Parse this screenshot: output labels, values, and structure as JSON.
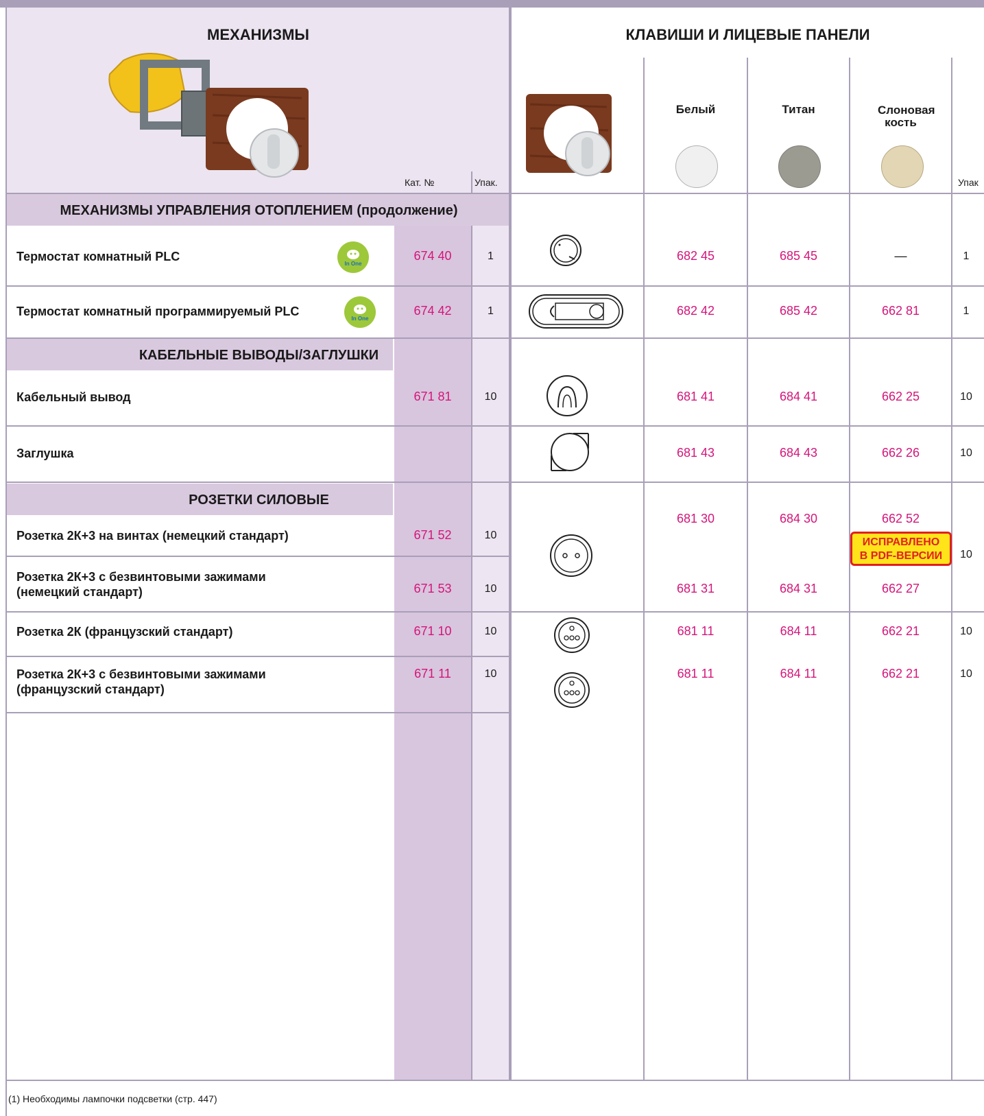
{
  "left_header": {
    "title": "МЕХАНИЗМЫ",
    "cat_label": "Кат. №",
    "pack_label": "Упак."
  },
  "right_header": {
    "title": "КЛАВИШИ И ЛИЦЕВЫЕ ПАНЕЛИ",
    "colors": [
      {
        "name": "Белый",
        "swatch": "#f0f0f0"
      },
      {
        "name": "Титан",
        "swatch": "#9c9b92"
      },
      {
        "name": "Слоновая кость",
        "swatch": "#e3d6b4"
      }
    ],
    "pack_label": "Упак"
  },
  "sections": {
    "heating": "МЕХАНИЗМЫ УПРАВЛЕНИЯ ОТОПЛЕНИЕМ (продолжение)",
    "cable": "КАБЕЛЬНЫЕ ВЫВОДЫ/ЗАГЛУШКИ",
    "sockets": "РОЗЕТКИ СИЛОВЫЕ"
  },
  "badge": "In One",
  "rows": [
    {
      "label": "Термостат комнатный PLC",
      "cat": "674 40",
      "pack": "1",
      "white": "682 45",
      "titan": "685 45",
      "ivory": "—",
      "pack2": "1"
    },
    {
      "label": "Термостат комнатный программируемый PLC",
      "cat": "674 42",
      "pack": "1",
      "white": "682 42",
      "titan": "685 42",
      "ivory": "662 81",
      "pack2": "1"
    },
    {
      "label": "Кабельный вывод",
      "cat": "671 81",
      "pack": "10",
      "white": "681 41",
      "titan": "684 41",
      "ivory": "662 25",
      "pack2": "10"
    },
    {
      "label": "Заглушка",
      "cat": "",
      "pack": "",
      "white": "681 43",
      "titan": "684 43",
      "ivory": "662 26",
      "pack2": "10"
    },
    {
      "label": "Розетка 2К+3 на винтах (немецкий стандарт)",
      "cat": "671 52",
      "pack": "10",
      "white": "681 30",
      "titan": "684 30",
      "ivory": "662 52",
      "pack2": "10"
    },
    {
      "label_line1": "Розетка 2К+3 с безвинтовыми зажимами",
      "label_line2": "(немецкий стандарт)",
      "cat": "671 53",
      "pack": "10",
      "white": "681 31",
      "titan": "684 31",
      "ivory": "662 27"
    },
    {
      "label": "Розетка 2К (французский стандарт)",
      "cat": "671 10",
      "pack": "10",
      "white": "681 11",
      "titan": "684 11",
      "ivory": "662 21",
      "pack2": "10"
    },
    {
      "label_line1": "Розетка 2К+3 с безвинтовыми зажимами",
      "label_line2": "(французский стандарт)",
      "cat": "671 11",
      "pack": "10",
      "white": "681 11",
      "titan": "684 11",
      "ivory": "662 21",
      "pack2": "10"
    }
  ],
  "stamp": {
    "line1": "ИСПРАВЛЕНО",
    "line2": "В PDF-ВЕРСИИ"
  },
  "footnote": "(1) Необходимы лампочки подсветки (стр. 447)"
}
